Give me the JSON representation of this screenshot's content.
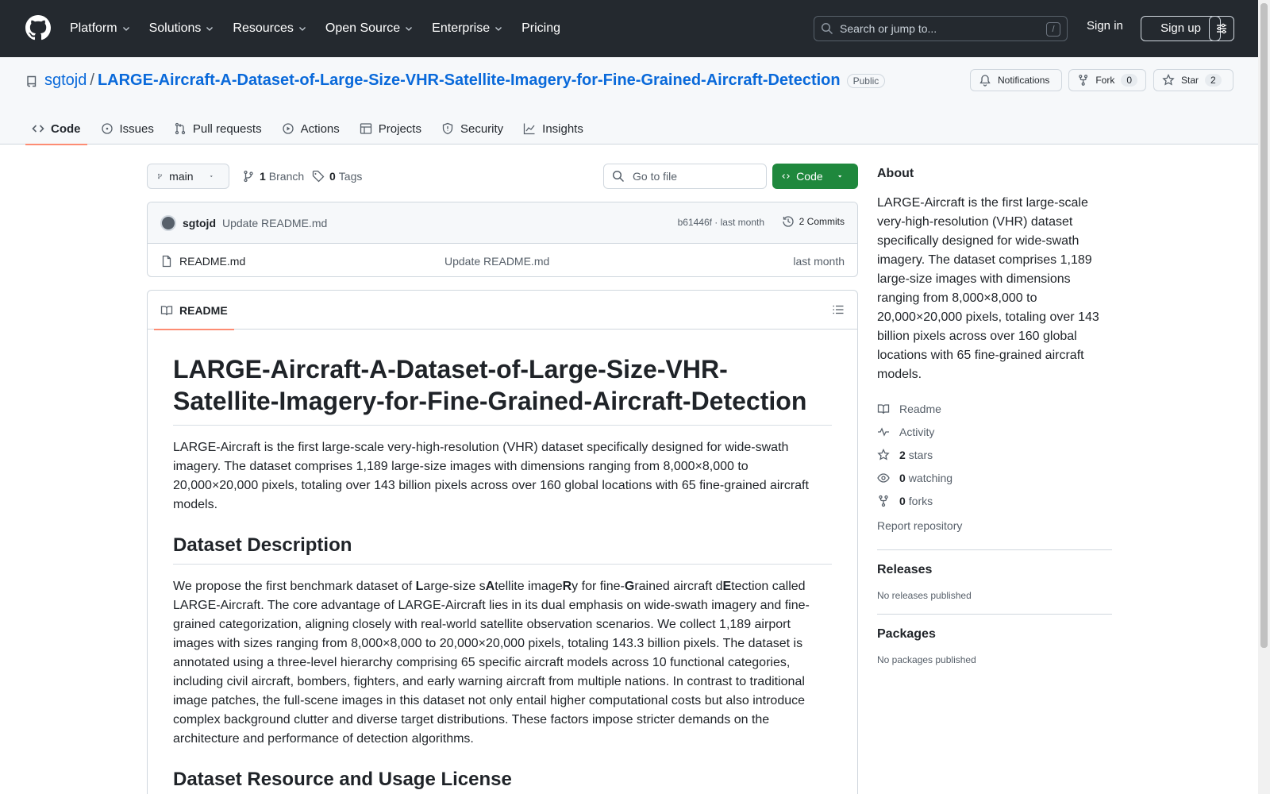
{
  "header": {
    "nav": [
      {
        "label": "Platform",
        "dropdown": true
      },
      {
        "label": "Solutions",
        "dropdown": true
      },
      {
        "label": "Resources",
        "dropdown": true
      },
      {
        "label": "Open Source",
        "dropdown": true
      },
      {
        "label": "Enterprise",
        "dropdown": true
      },
      {
        "label": "Pricing",
        "dropdown": false
      }
    ],
    "search_placeholder": "Search or jump to...",
    "search_shortcut": "/",
    "sign_in": "Sign in",
    "sign_up": "Sign up"
  },
  "repo": {
    "owner": "sgtojd",
    "separator": "/",
    "name": "LARGE-Aircraft-A-Dataset-of-Large-Size-VHR-Satellite-Imagery-for-Fine-Grained-Aircraft-Detection",
    "visibility": "Public",
    "notifications_label": "Notifications",
    "fork_label": "Fork",
    "fork_count": "0",
    "star_label": "Star",
    "star_count": "2",
    "tabs": [
      {
        "label": "Code",
        "icon": "code-icon",
        "active": true
      },
      {
        "label": "Issues",
        "icon": "issue-icon",
        "active": false
      },
      {
        "label": "Pull requests",
        "icon": "pull-request-icon",
        "active": false
      },
      {
        "label": "Actions",
        "icon": "play-icon",
        "active": false
      },
      {
        "label": "Projects",
        "icon": "table-icon",
        "active": false
      },
      {
        "label": "Security",
        "icon": "shield-icon",
        "active": false
      },
      {
        "label": "Insights",
        "icon": "graph-icon",
        "active": false
      }
    ]
  },
  "toolbar": {
    "branch": "main",
    "branch_count": "1",
    "branch_label": "Branch",
    "tag_count": "0",
    "tag_label": "Tags",
    "goto_placeholder": "Go to file",
    "code_button": "Code"
  },
  "commit": {
    "author": "sgtojd",
    "message": "Update README.md",
    "hash_date": "b61446f · last month",
    "commits_count": "2 Commits"
  },
  "files": [
    {
      "name": "README.md",
      "message": "Update README.md",
      "date": "last month"
    }
  ],
  "readme": {
    "tab_label": "README",
    "title": "LARGE-Aircraft-A-Dataset-of-Large-Size-VHR-Satellite-Imagery-for-Fine-Grained-Aircraft-Detection",
    "intro": "LARGE-Aircraft is the first large-scale very-high-resolution (VHR) dataset specifically designed for wide-swath imagery. The dataset comprises 1,189 large-size images with dimensions ranging from 8,000×8,000 to 20,000×20,000 pixels, totaling over 143 billion pixels across over 160 global locations with 65 fine-grained aircraft models.",
    "h2_description": "Dataset Description",
    "desc_lead": "We propose the first benchmark dataset of ",
    "acronym_parts": [
      {
        "bold": "L",
        "text": "arge-size s"
      },
      {
        "bold": "A",
        "text": "tellite image"
      },
      {
        "bold": "R",
        "text": "y for fine-"
      },
      {
        "bold": "G",
        "text": "rained aircraft d"
      },
      {
        "bold": "E",
        "text": "tection called"
      }
    ],
    "desc_rest": " LARGE-Aircraft. The core advantage of LARGE-Aircraft lies in its dual emphasis on wide-swath imagery and fine-grained categorization, aligning closely with real-world satellite observation scenarios. We collect 1,189 airport images with sizes ranging from 8,000×8,000 to 20,000×20,000 pixels, totaling 143.3 billion pixels. The dataset is annotated using a three-level hierarchy comprising 65 specific aircraft models across 10 functional categories, including civil aircraft, bombers, fighters, and early warning aircraft from multiple nations. In contrast to traditional image patches, the full-scene images in this dataset not only entail higher computational costs but also introduce complex background clutter and diverse target distributions. These factors impose stricter demands on the architecture and performance of detection algorithms.",
    "h2_license": "Dataset Resource and Usage License"
  },
  "sidebar": {
    "about_title": "About",
    "about_text": "LARGE-Aircraft is the first large-scale very-high-resolution (VHR) dataset specifically designed for wide-swath imagery. The dataset comprises 1,189 large-size images with dimensions ranging from 8,000×8,000 to 20,000×20,000 pixels, totaling over 143 billion pixels across over 160 global locations with 65 fine-grained aircraft models.",
    "readme": "Readme",
    "activity": "Activity",
    "stars_count": "2",
    "stars_label": "stars",
    "watching_count": "0",
    "watching_label": "watching",
    "forks_count": "0",
    "forks_label": "forks",
    "report": "Report repository",
    "releases_title": "Releases",
    "releases_empty": "No releases published",
    "packages_title": "Packages",
    "packages_empty": "No packages published"
  },
  "colors": {
    "header_bg": "#24292f",
    "link": "#0969da",
    "primary_button": "#1f883d",
    "active_tab_underline": "#fd8c73"
  }
}
